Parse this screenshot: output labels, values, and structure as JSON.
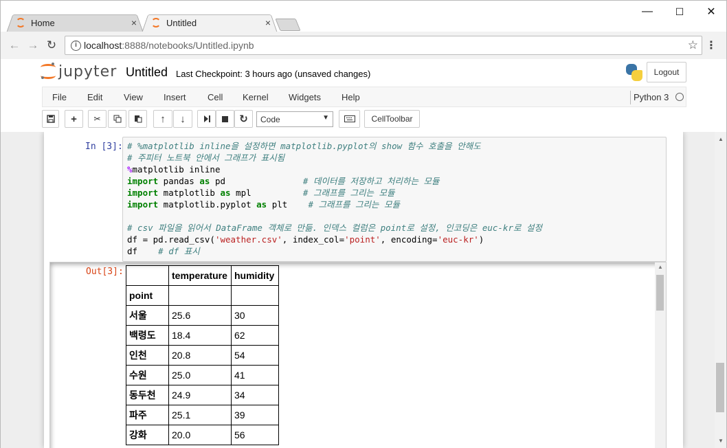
{
  "browser": {
    "tabs": [
      {
        "label": "Home",
        "close": "×"
      },
      {
        "label": "Untitled",
        "close": "×"
      }
    ],
    "window_controls": {
      "minimize": "—",
      "maximize": "☐",
      "close": "✕"
    },
    "address": {
      "host": "localhost",
      "path": ":8888/notebooks/Untitled.ipynb"
    }
  },
  "jupyter": {
    "logo_text": "jupyter",
    "notebook_title": "Untitled",
    "checkpoint_label": "Last Checkpoint:",
    "checkpoint_value": "3 hours ago (unsaved changes)",
    "logout_label": "Logout",
    "menu": [
      "File",
      "Edit",
      "View",
      "Insert",
      "Cell",
      "Kernel",
      "Widgets",
      "Help"
    ],
    "kernel_name": "Python 3",
    "cell_type": "Code",
    "celltoolbar_label": "CellToolbar"
  },
  "cell": {
    "in_prompt": "In [3]:",
    "out_prompt": "Out[3]:",
    "code": {
      "l1": "# %matplotlib inline을 설정하면 matplotlib.pyplot의 show 함수 호출을 안해도",
      "l2": "# 주피터 노트북 안에서 그래프가 표시됨",
      "l3_magic": "%",
      "l3_rest": "matplotlib inline",
      "l4_code": " pandas ",
      "l4_alias": " pd               ",
      "l4_comment": "# 데이터를 저장하고 처리하는 모듈",
      "l5_code": " matplotlib ",
      "l5_alias": " mpl          ",
      "l5_comment": "# 그래프를 그리는 모듈",
      "l6_code": " matplotlib.pyplot ",
      "l6_alias": " plt    ",
      "l6_comment": "# 그래프를 그리는 모듈",
      "l8": "# csv 파일을 읽어서 DataFrame 객체로 만듦. 인덱스 컬럼은 point로 설정, 인코딩은 euc-kr로 설정",
      "l9_a": "df = pd.read_csv(",
      "l9_s1": "'weather.csv'",
      "l9_b": ", index_col=",
      "l9_s2": "'point'",
      "l9_c": ", encoding=",
      "l9_s3": "'euc-kr'",
      "l9_d": ")",
      "l10_code": "df    ",
      "l10_comment": "# df 표시",
      "kw_import": "import",
      "kw_as": "as"
    },
    "table": {
      "columns": [
        "temperature",
        "humidity"
      ],
      "index_name": "point",
      "rows": [
        {
          "point": "서울",
          "temperature": "25.6",
          "humidity": "30"
        },
        {
          "point": "백령도",
          "temperature": "18.4",
          "humidity": "62"
        },
        {
          "point": "인천",
          "temperature": "20.8",
          "humidity": "54"
        },
        {
          "point": "수원",
          "temperature": "25.0",
          "humidity": "41"
        },
        {
          "point": "동두천",
          "temperature": "24.9",
          "humidity": "34"
        },
        {
          "point": "파주",
          "temperature": "25.1",
          "humidity": "39"
        },
        {
          "point": "강화",
          "temperature": "20.0",
          "humidity": "56"
        }
      ]
    }
  },
  "colors": {
    "accent": "#f37726",
    "prompt_in": "#303f9f",
    "prompt_out": "#d84315"
  }
}
